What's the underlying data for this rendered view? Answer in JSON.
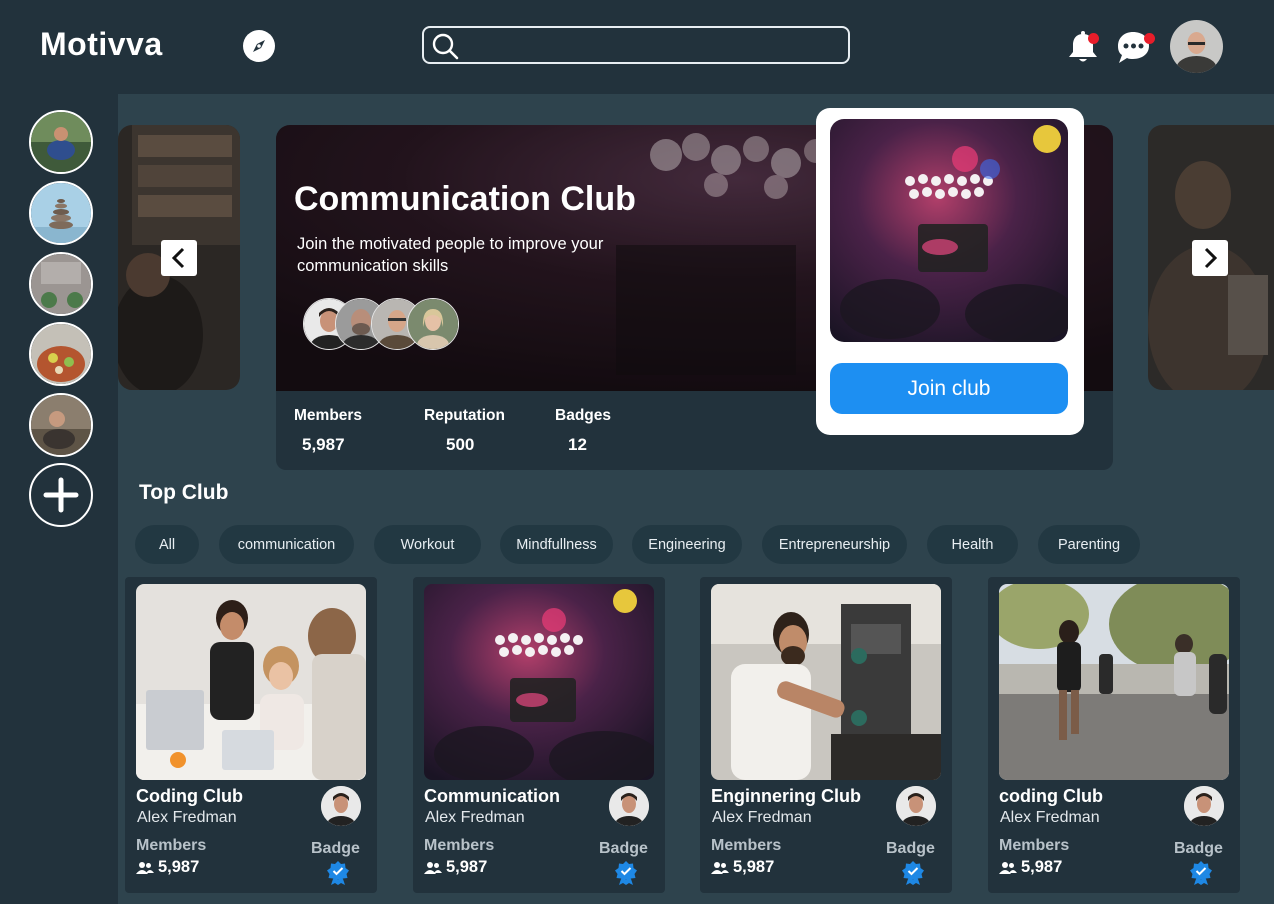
{
  "app": {
    "title": "Motivva"
  },
  "search": {
    "placeholder": "",
    "value": ""
  },
  "notifications": {
    "bell_has_unread": true,
    "chat_has_unread": true
  },
  "colors": {
    "background": "#22323c",
    "panel": "#2e434d",
    "accent": "#1d8ff2",
    "unread_dot": "#e81d2a",
    "badge": "#1e88e5"
  },
  "sidebar": {
    "stories": [
      {
        "name": "story-1"
      },
      {
        "name": "story-2"
      },
      {
        "name": "story-3"
      },
      {
        "name": "story-4"
      },
      {
        "name": "story-5"
      }
    ],
    "add_icon": "plus-icon"
  },
  "hero": {
    "title": "Communication Club",
    "subtitle": "Join the  motivated people to improve your communication skills",
    "stats": [
      {
        "label": "Members",
        "value": "5,987"
      },
      {
        "label": "Reputation",
        "value": "500"
      },
      {
        "label": "Badges",
        "value": "12"
      }
    ],
    "prev_icon": "chevron-left-icon",
    "next_icon": "chevron-right-icon"
  },
  "popup": {
    "join_label": "Join club"
  },
  "top_club": {
    "title": "Top Club",
    "filters": [
      "All",
      "communication",
      "Workout",
      "Mindfullness",
      "Engineering",
      "Entrepreneurship",
      "Health",
      "Parenting"
    ],
    "clubs": [
      {
        "name": "Coding Club",
        "owner": "Alex Fredman",
        "members_label": "Members",
        "members": "5,987",
        "badge_label": "Badge"
      },
      {
        "name": "Communication",
        "owner": "Alex Fredman",
        "members_label": "Members",
        "members": "5,987",
        "badge_label": "Badge"
      },
      {
        "name": "Enginnering Club",
        "owner": "Alex Fredman",
        "members_label": "Members",
        "members": "5,987",
        "badge_label": "Badge"
      },
      {
        "name": "coding Club",
        "owner": "Alex Fredman",
        "members_label": "Members",
        "members": "5,987",
        "badge_label": "Badge"
      }
    ]
  }
}
